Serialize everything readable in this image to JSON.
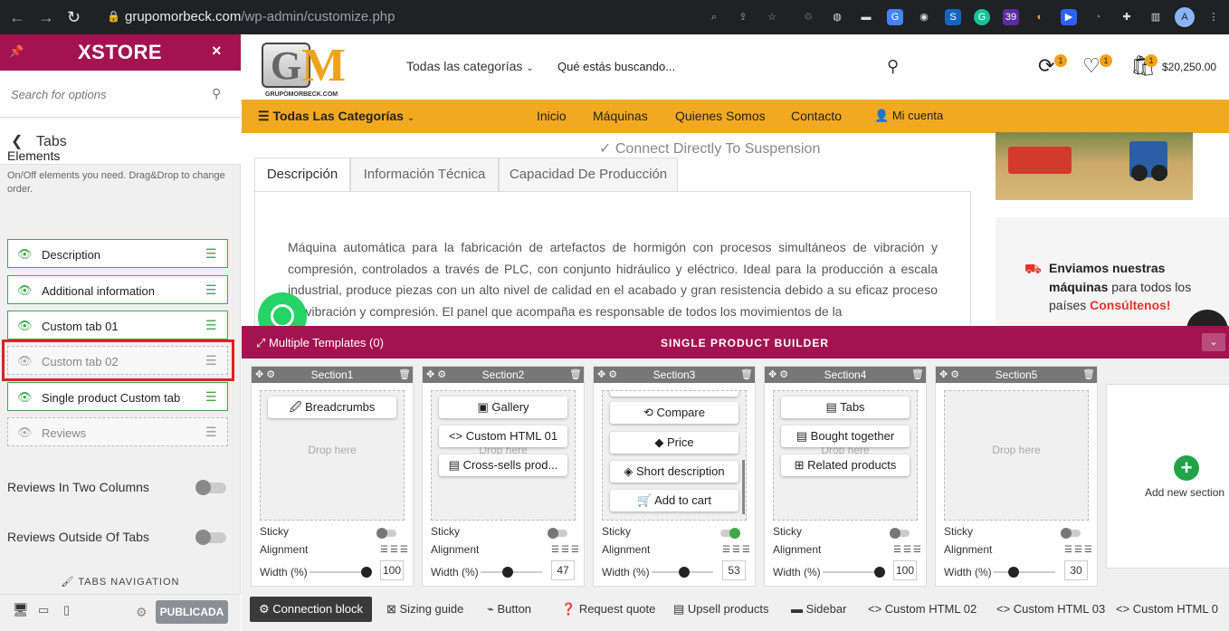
{
  "browser": {
    "url_host": "grupomorbeck.com",
    "url_path": "/wp-admin/customize.php",
    "ext_badge": "39",
    "profile": "A"
  },
  "sidebar": {
    "brand": "XSTORE",
    "search_placeholder": "Search for options",
    "section_title": "Tabs",
    "elements_title": "Elements",
    "elements_desc": "On/Off elements you need. Drag&Drop to change order.",
    "items": [
      {
        "label": "Description",
        "enabled": true
      },
      {
        "label": "Additional information",
        "enabled": true
      },
      {
        "label": "Custom tab 01",
        "enabled": true
      },
      {
        "label": "Custom tab 02",
        "enabled": false
      },
      {
        "label": "Single product Custom tab",
        "enabled": true
      },
      {
        "label": "Reviews",
        "enabled": false
      }
    ],
    "toggles": [
      {
        "label": "Reviews In Two Columns",
        "on": false
      },
      {
        "label": "Reviews Outside Of Tabs",
        "on": false
      }
    ],
    "tabs_navigation": "TABS NAVIGATION",
    "publish_label": "PUBLICADA"
  },
  "site": {
    "logo_sub": "GRUPOMORBECK.COM",
    "categories": "Todas las categorías",
    "search_placeholder": "Qué estás buscando...",
    "badges": {
      "compare": "1",
      "wishlist": "1",
      "cart": "1"
    },
    "cart_total": "$20,250.00",
    "menu": {
      "all_categories": "Todas Las Categorías",
      "items": [
        "Inicio",
        "Máquinas",
        "Quienes Somos",
        "Contacto"
      ],
      "account": "Mi cuenta"
    },
    "connect_line": "Connect Directly To Suspension",
    "tabs": [
      "Descripción",
      "Información Técnica",
      "Capacidad De Producción"
    ],
    "description": "Máquina automática para la fabricación de artefactos de hormigón con procesos simultáneos de vibración y compresión, controlados a través de PLC, con conjunto hidráulico y eléctrico. Ideal para la producción a escala industrial, produce piezas con un alto nivel de calidad en el acabado y gran resistencia debido a su eficaz proceso de vibración y compresión. El panel que acompaña es responsable de todos los movimientos de la",
    "shipping": {
      "bold": "Enviamos nuestras máquinas",
      "rest": "para todos los países",
      "cta": "Consúltenos!"
    }
  },
  "builder": {
    "multiple_templates": "Multiple Templates (0)",
    "title": "SINGLE PRODUCT BUILDER",
    "drop_here": "Drop here",
    "sticky_label": "Sticky",
    "alignment_label": "Alignment",
    "width_label": "Width (%)",
    "add_new": "Add new section",
    "sections": [
      {
        "name": "Section1",
        "blocks": [
          "🖉 Breadcrumbs"
        ],
        "sticky": false,
        "width": "100"
      },
      {
        "name": "Section2",
        "blocks": [
          "▣ Gallery",
          "<> Custom HTML 01",
          "▤ Cross-sells prod..."
        ],
        "sticky": false,
        "width": "47"
      },
      {
        "name": "Section3",
        "blocks": [
          "⟲ Compare",
          "◆ Price",
          "◈ Short description",
          "🛒 Add to cart"
        ],
        "sticky": true,
        "width": "53"
      },
      {
        "name": "Section4",
        "blocks": [
          "▤ Tabs",
          "▤ Bought together",
          "⊞ Related products"
        ],
        "sticky": false,
        "width": "100"
      },
      {
        "name": "Section5",
        "blocks": [],
        "sticky": false,
        "width": "30"
      }
    ],
    "bottom_items": [
      "Connection block",
      "Sizing guide",
      "Button",
      "Request quote",
      "Upsell products",
      "Sidebar",
      "Custom HTML 02",
      "Custom HTML 03",
      "Custom HTML 0"
    ]
  }
}
